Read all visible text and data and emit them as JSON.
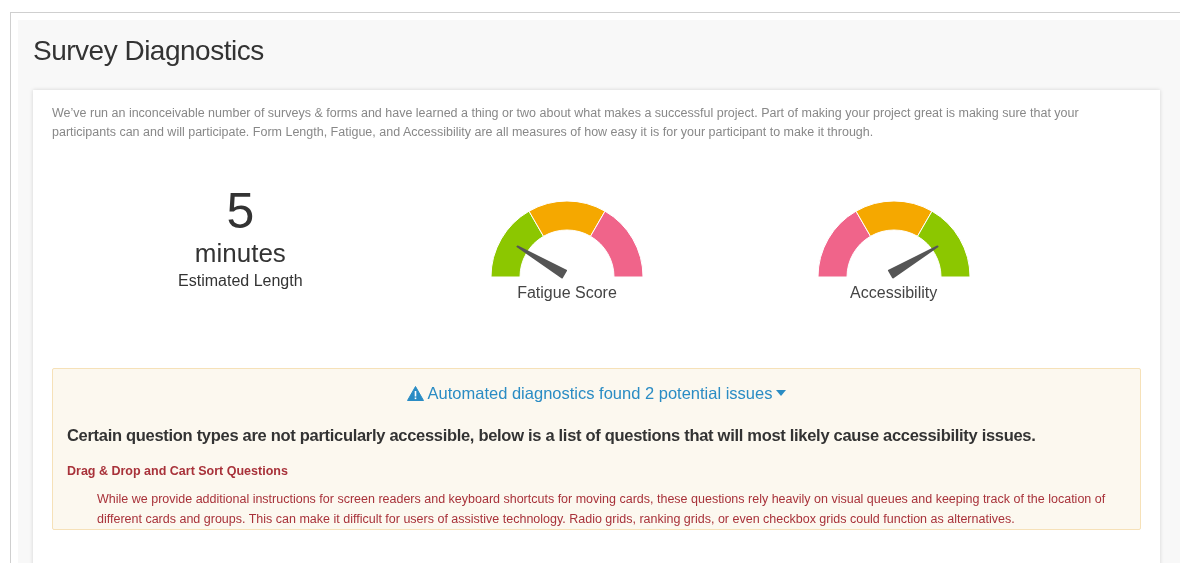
{
  "title": "Survey Diagnostics",
  "intro": "We’ve run an inconceivable number of surveys & forms and have learned a thing or two about what makes a successful project. Part of making your project great is making sure that your participants can and will participate. Form Length, Fatigue, and Accessibility are all measures of how easy it is for your participant to make it through.",
  "metrics": [
    {
      "kind": "number",
      "value": "5",
      "unit": "minutes",
      "label": "Estimated Length"
    },
    {
      "kind": "gauge",
      "label": "Fatigue Score",
      "segments": [
        {
          "color": "#8cc700"
        },
        {
          "color": "#f5a800"
        },
        {
          "color": "#f0648a"
        }
      ]
    },
    {
      "kind": "gauge",
      "label": "Accessibility",
      "segments": [
        {
          "color": "#f0648a"
        },
        {
          "color": "#f5a800"
        },
        {
          "color": "#8cc700"
        }
      ]
    }
  ],
  "alert": {
    "heading": "Automated diagnostics found 2 potential issues",
    "expanded": true,
    "summary": "Certain question types are not particularly accessible, below is a list of questions that will most likely cause accessibility issues.",
    "issues": [
      {
        "title": "Drag & Drop and Cart Sort Questions",
        "description": "While we provide additional instructions for screen readers and keyboard shortcuts for moving cards, these questions rely heavily on visual queues and keeping track of the location of different cards and groups. This can make it difficult for users of assistive technology. Radio grids, ranking grids, or even checkbox grids could function as alternatives."
      }
    ]
  }
}
